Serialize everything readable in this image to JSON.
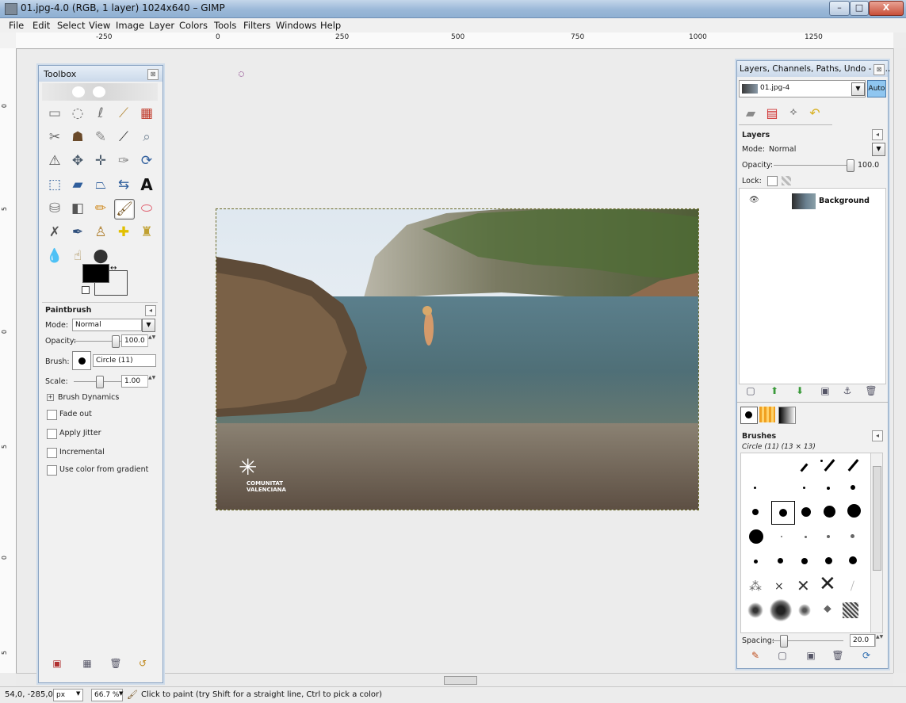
{
  "window": {
    "title": "01.jpg-4.0 (RGB, 1 layer) 1024x640 – GIMP",
    "controls": {
      "minimize": "–",
      "maximize": "□",
      "close": "X"
    }
  },
  "menu": [
    "File",
    "Edit",
    "Select",
    "View",
    "Image",
    "Layer",
    "Colors",
    "Tools",
    "Filters",
    "Windows",
    "Help"
  ],
  "ruler": {
    "h_labels": [
      "-250",
      "0",
      "250",
      "500",
      "750",
      "1000",
      "1250"
    ],
    "v_labels": [
      "0",
      "5",
      "0",
      "5",
      "0",
      "5"
    ]
  },
  "toolbox": {
    "title": "Toolbox",
    "close": "⊠",
    "tools": [
      [
        "rect-select",
        "ellipse-select",
        "free-select",
        "fuzzy-select",
        "color-select"
      ],
      [
        "scissors",
        "foreground-select",
        "paths",
        "color-picker",
        "zoom"
      ],
      [
        "measure",
        "move",
        "align",
        "crop",
        "rotate"
      ],
      [
        "scale",
        "shear",
        "perspective",
        "flip",
        "text"
      ],
      [
        "bucket-fill",
        "blend",
        "pencil",
        "paintbrush",
        "eraser"
      ],
      [
        "airbrush",
        "ink",
        "clone",
        "heal",
        "perspective-clone"
      ],
      [
        "blur",
        "smudge",
        "dodge-burn"
      ]
    ],
    "selected_tool": "paintbrush",
    "fg_color": "#000000",
    "bg_color": "#ffffff",
    "options": {
      "title": "Paintbrush",
      "mode_label": "Mode:",
      "mode_value": "Normal",
      "opacity_label": "Opacity:",
      "opacity_value": "100.0",
      "brush_label": "Brush:",
      "brush_value": "Circle (11)",
      "scale_label": "Scale:",
      "scale_value": "1.00",
      "dynamics_label": "Brush Dynamics",
      "checkboxes": [
        "Fade out",
        "Apply Jitter",
        "Incremental",
        "Use color from gradient"
      ]
    }
  },
  "layers_dock": {
    "title": "Layers, Channels, Paths, Undo - Br...",
    "close": "⊠",
    "image_select": "01.jpg-4",
    "auto_label": "Auto",
    "layers": {
      "title": "Layers",
      "mode_label": "Mode:",
      "mode_value": "Normal",
      "opacity_label": "Opacity:",
      "opacity_value": "100.0",
      "lock_label": "Lock:",
      "layer_name": "Background"
    },
    "brushes": {
      "title": "Brushes",
      "current": "Circle (11) (13 × 13)",
      "spacing_label": "Spacing:",
      "spacing_value": "20.0"
    }
  },
  "canvas": {
    "logo_line1": "COMUNITAT",
    "logo_line2": "VALENCIANA"
  },
  "statusbar": {
    "coords": "54,0, -285,0",
    "unit": "px",
    "zoom": "66.7 %",
    "message": "Click to paint (try Shift for a straight line, Ctrl to pick a color)"
  },
  "colors": {
    "title_bar": "#9bb8d8",
    "dock_border": "#8aa4c3",
    "auto_button": "#8fc6f0"
  }
}
